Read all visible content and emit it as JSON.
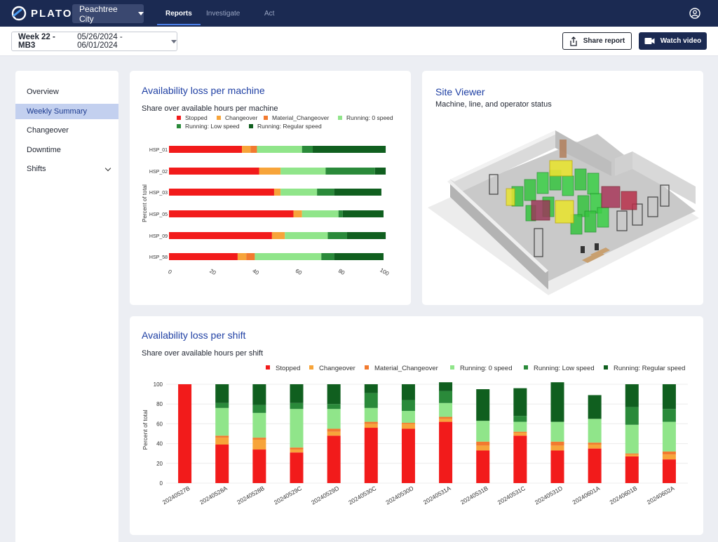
{
  "nav": {
    "brand": "PLATO",
    "site": "Peachtree City",
    "tabs": [
      {
        "label": "Reports",
        "active": true
      },
      {
        "label": "Investigate",
        "active": false
      },
      {
        "label": "Act",
        "active": false
      }
    ]
  },
  "toolbar": {
    "week_label": "Week 22 - MB3",
    "date_range": "05/26/2024 - 06/01/2024",
    "share_label": "Share report",
    "video_label": "Watch video"
  },
  "sidebar": {
    "items": [
      {
        "label": "Overview",
        "active": false
      },
      {
        "label": "Weekly Summary",
        "active": true
      },
      {
        "label": "Changeover",
        "active": false
      },
      {
        "label": "Downtime",
        "active": false
      },
      {
        "label": "Shifts",
        "active": false,
        "expandable": true
      }
    ]
  },
  "colors": {
    "Stopped": "#f21b1b",
    "Changeover": "#f7a43a",
    "Material_Changeover": "#f27a2f",
    "Running: 0 speed": "#90e58a",
    "Running: Low speed": "#2a8a3a",
    "Running: Regular speed": "#105f1f"
  },
  "machine_card": {
    "title": "Availability loss per machine",
    "subtitle": "Share over available hours per machine"
  },
  "site_viewer": {
    "title": "Site Viewer",
    "subtitle": "Machine, line, and operator status"
  },
  "shift_card": {
    "title": "Availability loss per shift",
    "subtitle": "Share over available hours per shift"
  },
  "chart_data": [
    {
      "type": "bar",
      "orientation": "horizontal",
      "stacked": true,
      "categories": [
        "HSP_01",
        "HSP_02",
        "HSP_03",
        "HSP_05",
        "HSP_09",
        "HSP_58"
      ],
      "ylabel": "Percent of total",
      "xlabel": "",
      "xlim": [
        0,
        100
      ],
      "xticks": [
        0,
        20,
        40,
        60,
        80,
        100
      ],
      "legend_position": "top",
      "series": [
        {
          "name": "Stopped",
          "values": [
            34,
            42,
            49,
            58,
            48,
            32
          ]
        },
        {
          "name": "Changeover",
          "values": [
            4,
            10,
            3,
            4,
            6,
            4
          ]
        },
        {
          "name": "Material_Changeover",
          "values": [
            3,
            0,
            0,
            0,
            0,
            4
          ]
        },
        {
          "name": "Running: 0 speed",
          "values": [
            21,
            21,
            17,
            17,
            20,
            31
          ]
        },
        {
          "name": "Running: Low speed",
          "values": [
            5,
            23,
            8,
            2,
            9,
            6
          ]
        },
        {
          "name": "Running: Regular speed",
          "values": [
            34,
            5,
            22,
            19,
            18,
            23
          ]
        }
      ]
    },
    {
      "type": "bar",
      "orientation": "vertical",
      "stacked": true,
      "categories": [
        "20240527B",
        "20240528A",
        "20240528B",
        "20240529C",
        "20240529D",
        "20240530C",
        "20240530D",
        "20240531A",
        "20240531B",
        "20240531C",
        "20240531D",
        "20240601A",
        "20240601B",
        "20240602A"
      ],
      "ylabel": "Percent of total",
      "xlabel": "",
      "ylim": [
        0,
        100
      ],
      "yticks": [
        0,
        20,
        40,
        60,
        80,
        100
      ],
      "legend_position": "top-right",
      "series": [
        {
          "name": "Stopped",
          "values": [
            100,
            39,
            34,
            31,
            48,
            56,
            55,
            62,
            33,
            48,
            33,
            35,
            27,
            24
          ]
        },
        {
          "name": "Changeover",
          "values": [
            0,
            7,
            10,
            3,
            4,
            4,
            5,
            3,
            5,
            3,
            5,
            4,
            2,
            5
          ]
        },
        {
          "name": "Material_Changeover",
          "values": [
            0,
            2,
            2,
            2,
            3,
            2,
            1,
            2,
            4,
            1,
            4,
            2,
            1,
            3
          ]
        },
        {
          "name": "Running: 0 speed",
          "values": [
            0,
            28,
            25,
            39,
            20,
            14,
            12,
            14,
            21,
            10,
            20,
            24,
            29,
            30
          ]
        },
        {
          "name": "Running: Low speed",
          "values": [
            0,
            5,
            8,
            6,
            5,
            15,
            11,
            12,
            0,
            6,
            0,
            0,
            18,
            13
          ]
        },
        {
          "name": "Running: Regular speed",
          "values": [
            0,
            19,
            21,
            19,
            20,
            9,
            16,
            9,
            32,
            28,
            40,
            24,
            23,
            25
          ]
        }
      ]
    }
  ]
}
